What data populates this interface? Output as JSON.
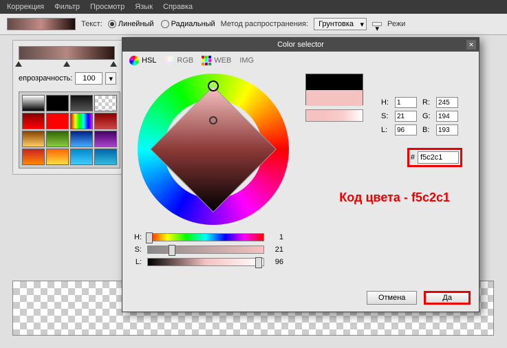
{
  "menubar": {
    "items": [
      "Коррекция",
      "Фильтр",
      "Просмотр",
      "Язык",
      "Справка"
    ]
  },
  "toolbar": {
    "text_label": "Текст:",
    "radio_linear": "Линейный",
    "radio_radial": "Радиальный",
    "method_label": "Метод распространения:",
    "method_value": "Грунтовка",
    "mode_label": "Режи"
  },
  "sidebar": {
    "opacity_label": "епрозрачность:",
    "opacity_value": "100"
  },
  "dialog": {
    "title": "Color selector",
    "tabs": {
      "hsl": "HSL",
      "rgb": "RGB",
      "web": "WEB",
      "img": "IMG"
    },
    "sliders": {
      "h": {
        "label": "H:",
        "value": "1"
      },
      "s": {
        "label": "S:",
        "value": "21"
      },
      "l": {
        "label": "L:",
        "value": "96"
      }
    },
    "values": {
      "h_label": "H:",
      "h": "1",
      "s_label": "S:",
      "s": "21",
      "l_label": "L:",
      "l": "96",
      "r_label": "R:",
      "r": "245",
      "g_label": "G:",
      "g": "194",
      "b_label": "B:",
      "b": "193"
    },
    "hex_label": "#",
    "hex_value": "f5c2c1",
    "cancel": "Отмена",
    "ok": "Да"
  },
  "annotation": "Код цвета - f5c2c1"
}
